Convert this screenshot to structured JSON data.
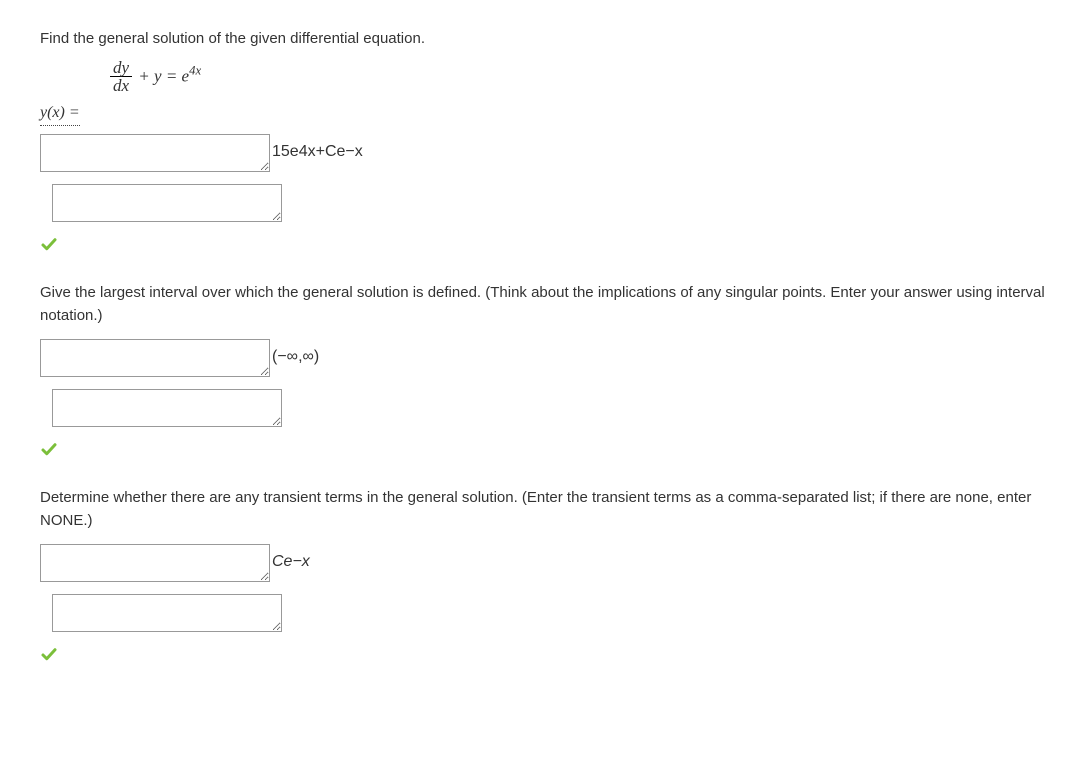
{
  "q1": {
    "prompt": "Find the general solution of the given differential equation.",
    "eq_num": "dy",
    "eq_den": "dx",
    "eq_mid": " + y = e",
    "eq_sup": "4x",
    "yx_label": "y(x) =",
    "answer_display": "15e4x+Ce−x"
  },
  "q2": {
    "prompt": "Give the largest interval over which the general solution is defined. (Think about the implications of any singular points. Enter your answer using interval notation.)",
    "answer_display": "(−∞,∞)"
  },
  "q3": {
    "prompt": "Determine whether there are any transient terms in the general solution. (Enter the transient terms as a comma-separated list; if there are none, enter NONE.)",
    "answer_display": "Ce−x"
  }
}
